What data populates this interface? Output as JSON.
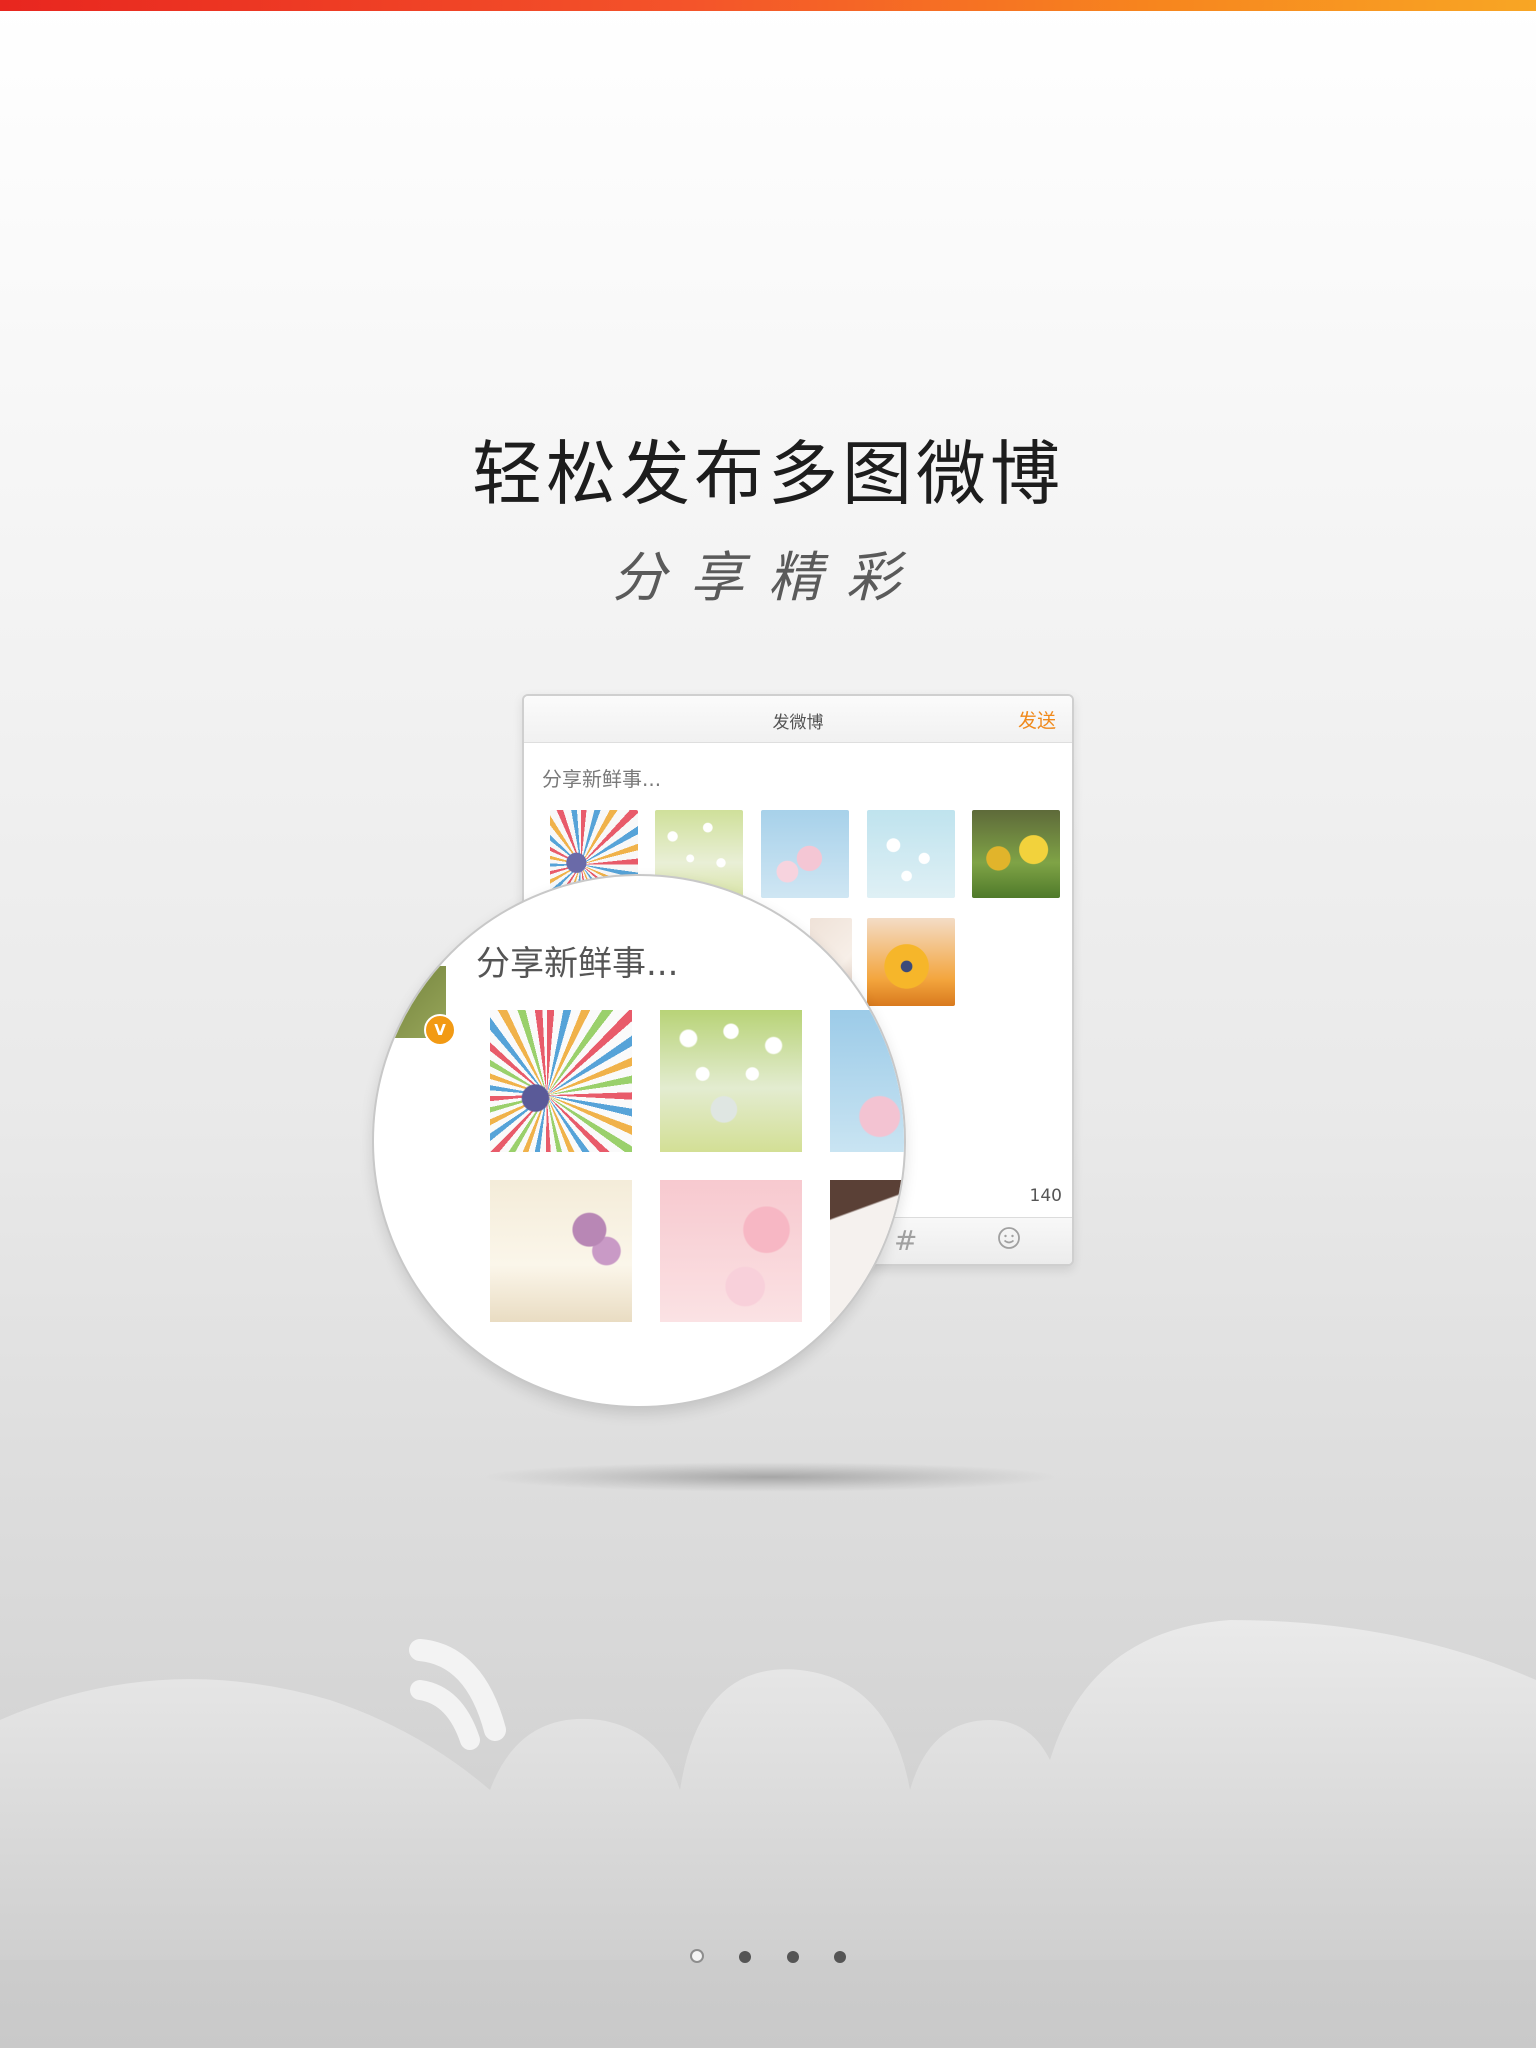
{
  "headline": "轻松发布多图微博",
  "tagline": "分享精彩",
  "compose_card": {
    "title": "发微博",
    "send_label": "发送",
    "placeholder": "分享新鲜事...",
    "char_count": "140",
    "toolbar_icons": [
      "hashtag-icon",
      "emoji-icon"
    ]
  },
  "magnifier": {
    "placeholder": "分享新鲜事...",
    "badge": "V"
  },
  "pagination": {
    "total": 4,
    "active_index": 0
  },
  "colors": {
    "top_bar_start": "#e8261f",
    "top_bar_end": "#f8a624",
    "send_accent": "#f08a1c",
    "vip_badge": "#f29a14"
  }
}
